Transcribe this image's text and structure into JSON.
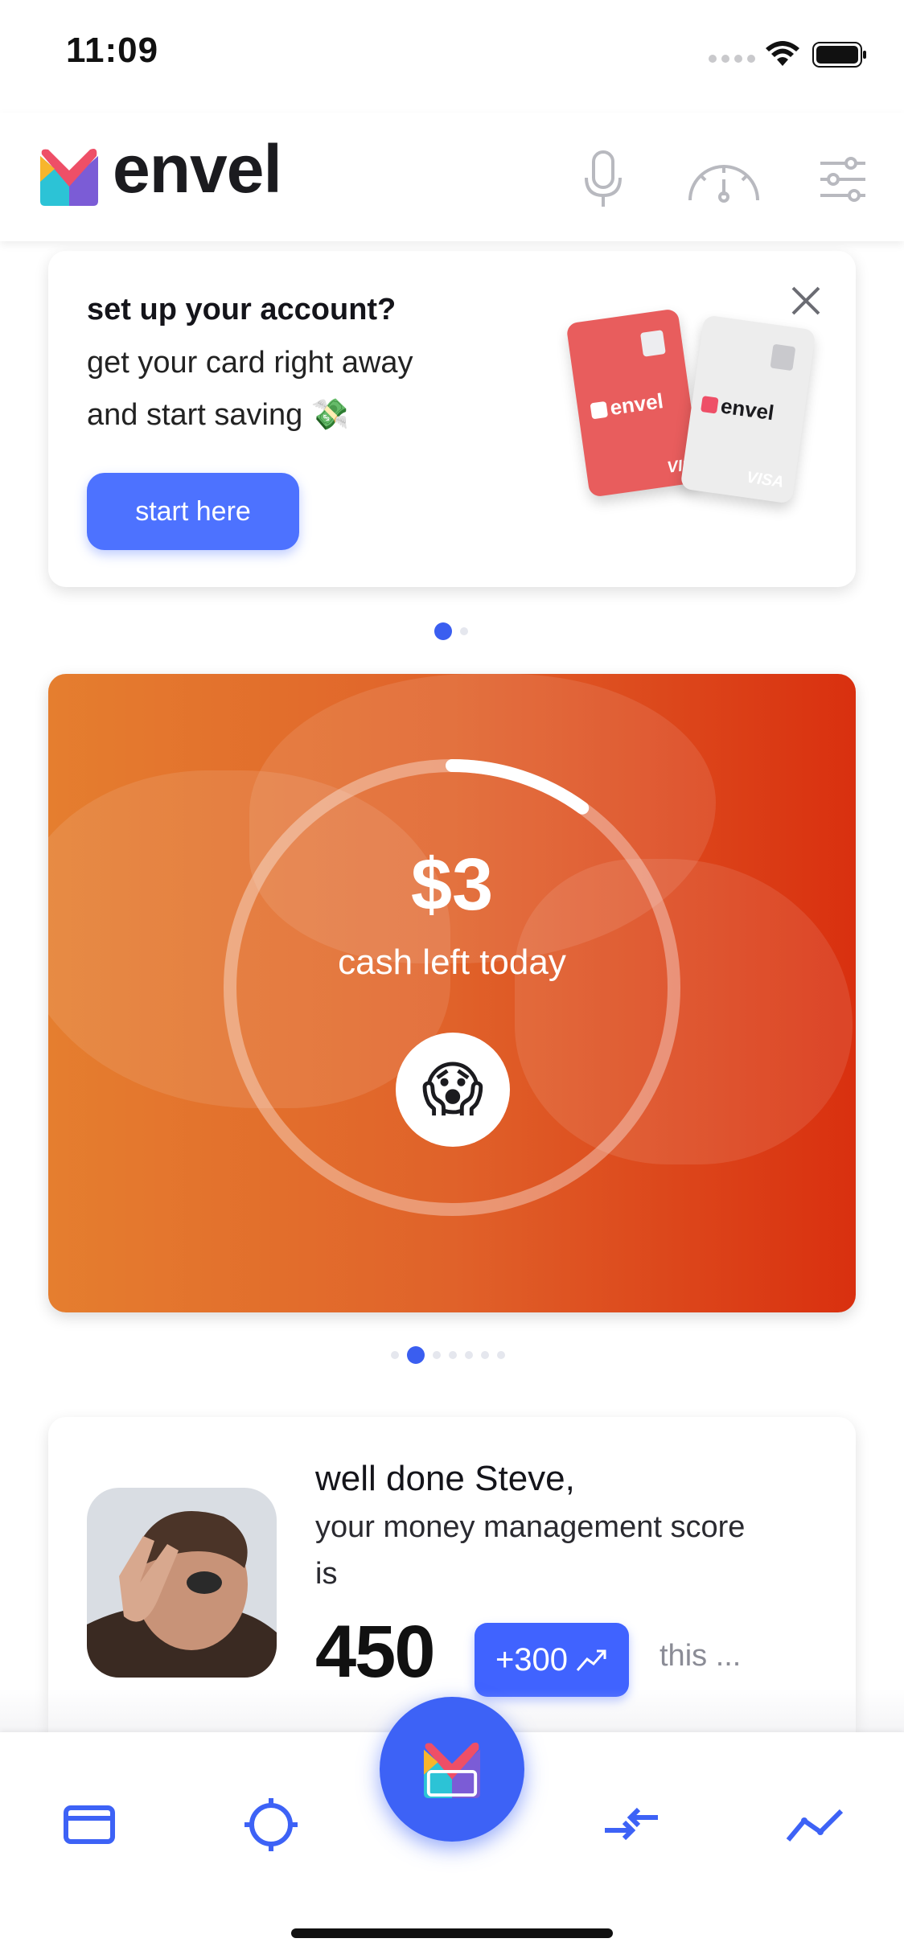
{
  "status_bar": {
    "time": "11:09"
  },
  "header": {
    "brand": "envel"
  },
  "promo": {
    "title": "set up your account?",
    "line1": "get your card right away",
    "line2": "and start saving 💸",
    "button": "start here",
    "card_brand": "envel",
    "card_network": "VISA"
  },
  "budget": {
    "amount": "$3",
    "label": "cash left today",
    "emoji": "😱",
    "progress_fraction": 0.1
  },
  "score": {
    "greeting": "well done Steve,",
    "line1": "your money management score",
    "line2": "is",
    "value": "450",
    "delta": "+300",
    "suffix": "this ..."
  },
  "colors": {
    "accent": "#3d62f6",
    "button": "#4d72ff",
    "orange_start": "#e57e2f",
    "orange_end": "#d9300f"
  },
  "icons": [
    "microphone-icon",
    "gauge-icon",
    "sliders-icon",
    "card-icon",
    "target-icon",
    "envel-logo-icon",
    "transfer-icon",
    "trend-icon"
  ]
}
